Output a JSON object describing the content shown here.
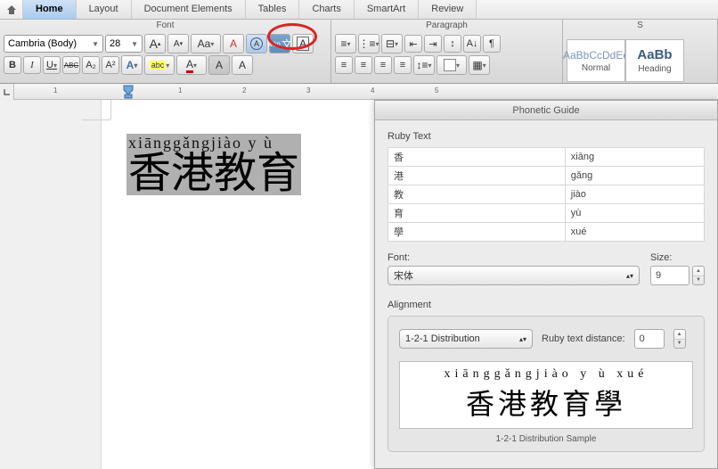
{
  "tabs": [
    "Home",
    "Layout",
    "Document Elements",
    "Tables",
    "Charts",
    "SmartArt",
    "Review"
  ],
  "active_tab_index": 0,
  "ribbon": {
    "font_group_label": "Font",
    "paragraph_group_label": "Paragraph",
    "styles_group_label": "S",
    "font_name": "Cambria (Body)",
    "font_size": "28",
    "grow_font": "A",
    "shrink_font": "A",
    "change_case": "Aa",
    "clear_formatting": "A",
    "encircle": "A",
    "phonetic_guide": "文",
    "border_char": "A",
    "bold": "B",
    "italic": "I",
    "underline": "U",
    "strike": "ABC",
    "sub": "A₂",
    "sup": "A²",
    "highlight_label": "abc",
    "font_color": "A",
    "shading": "A",
    "clear": "A",
    "style_normal_preview": "AaBbCcDdEe",
    "style_normal": "Normal",
    "style_heading_preview": "AaBb",
    "style_heading": "Heading"
  },
  "ruler_numbers": [
    "1",
    "1",
    "2",
    "3",
    "4",
    "5"
  ],
  "document": {
    "ruby": "xiānggǎngjiào y  ù",
    "base": "香港教育"
  },
  "dialog": {
    "title": "Phonetic Guide",
    "ruby_text_label": "Ruby Text",
    "rows": [
      {
        "base": "香",
        "ruby": "xiāng"
      },
      {
        "base": "港",
        "ruby": "gǎng"
      },
      {
        "base": "教",
        "ruby": "jiào"
      },
      {
        "base": "育",
        "ruby": "yù"
      },
      {
        "base": "學",
        "ruby": "xué"
      }
    ],
    "font_label": "Font:",
    "font_value": "宋体",
    "size_label": "Size:",
    "size_value": "9",
    "alignment_label": "Alignment",
    "alignment_value": "1-2-1 Distribution",
    "distance_label": "Ruby text distance:",
    "distance_value": "0",
    "preview_ruby": "xiānggǎngjiào y  ù xué",
    "preview_base": "香港教育學",
    "sample_caption": "1-2-1 Distribution Sample"
  }
}
